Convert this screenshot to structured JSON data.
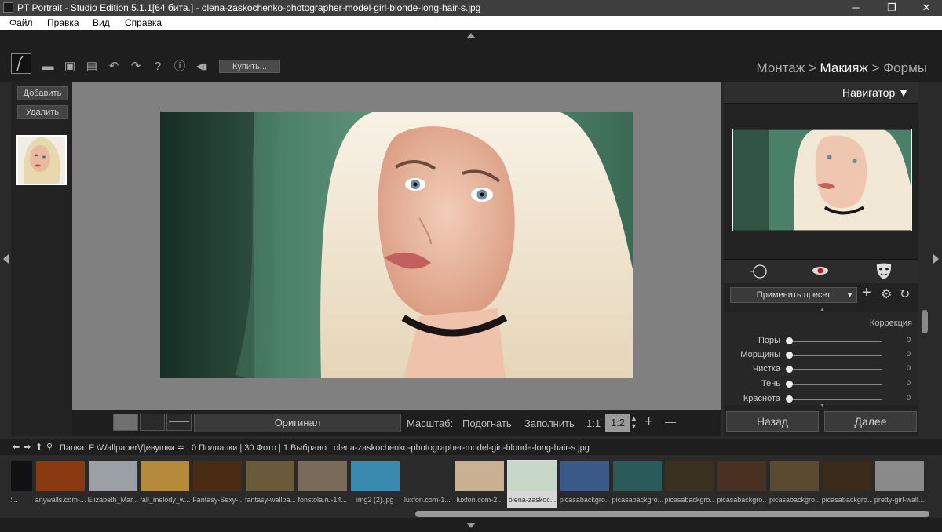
{
  "window": {
    "title": "PT Portrait - Studio Edition 5.1.1[64 бита.] - olena-zaskochenko-photographer-model-girl-blonde-long-hair-s.jpg",
    "minimize": "─",
    "maximize": "❐",
    "close": "✕"
  },
  "menu": {
    "items": [
      "Файл",
      "Правка",
      "Вид",
      "Справка"
    ]
  },
  "toolbar": {
    "buy_label": "Купить...",
    "icons": [
      "open-folder-icon",
      "save-icon",
      "save-as-icon",
      "undo-icon",
      "redo-icon",
      "help-icon",
      "info-icon",
      "plugin-icon"
    ],
    "glyphs": [
      "▬",
      "▣",
      "▤",
      "↶",
      "↷",
      "?",
      "ⓘ",
      "◀▮"
    ]
  },
  "breadcrumbs": {
    "step1": "Монтаж",
    "sep": ">",
    "step2": "Макияж",
    "step3": "Формы"
  },
  "left_panel": {
    "add_label": "Добавить",
    "remove_label": "Удалить"
  },
  "view": {
    "original_label": "Оригинал",
    "zoom_label": "Масштаб:",
    "fit_label": "Подогнать",
    "fill_label": "Заполнить",
    "one_to_one": "1:1",
    "zoom_value": "1:2",
    "plus": "+",
    "minus": "—"
  },
  "navigator": {
    "title": "Навигатор ▼",
    "preset_label": "Применить пресет",
    "section_title": "Коррекция",
    "sliders": [
      {
        "label": "Поры",
        "value": "0"
      },
      {
        "label": "Морщины",
        "value": "0"
      },
      {
        "label": "Чистка",
        "value": "0"
      },
      {
        "label": "Тень",
        "value": "0"
      },
      {
        "label": "Краснота",
        "value": "0"
      }
    ],
    "back_label": "Назад",
    "next_label": "Далее"
  },
  "path_bar": {
    "text": "Папка:  F:\\Wallpaper\\Девушки ≑ | 0 Подпапки | 30 Фото | 1 Выбрано | olena-zaskochenko-photographer-model-girl-blonde-long-hair-s.jpg"
  },
  "filmstrip": [
    {
      "caption": "86-2...",
      "color": "#111111"
    },
    {
      "caption": "anywalls.com-...",
      "color": "#8a3a10"
    },
    {
      "caption": "Elizabeth_Mar...",
      "color": "#9aa0a6"
    },
    {
      "caption": "fall_melody_w...",
      "color": "#b58a3a"
    },
    {
      "caption": "Fantasy-Sexy-...",
      "color": "#4a2a10"
    },
    {
      "caption": "fantasy-wallpa...",
      "color": "#6a5a3a"
    },
    {
      "caption": "fonstola.ru-14...",
      "color": "#7a6a5a"
    },
    {
      "caption": "img2 (2).jpg",
      "color": "#3a8ab0"
    },
    {
      "caption": "luxfon.com-1...",
      "color": "#2a2a2a"
    },
    {
      "caption": "luxfon.com-2...",
      "color": "#c8b090"
    },
    {
      "caption": "olena-zaskoc...",
      "color": "#c8d8c8"
    },
    {
      "caption": "picasabackgro...",
      "color": "#3a5a8a"
    },
    {
      "caption": "picasabackgro...",
      "color": "#2a5a5a"
    },
    {
      "caption": "picasabackgro...",
      "color": "#3a3020"
    },
    {
      "caption": "picasabackgro...",
      "color": "#4a3020"
    },
    {
      "caption": "picasabackgro...",
      "color": "#5a4a30"
    },
    {
      "caption": "picasabackgro...",
      "color": "#3a2a1a"
    },
    {
      "caption": "pretty-girl-wall...",
      "color": "#8a8a8a"
    }
  ]
}
